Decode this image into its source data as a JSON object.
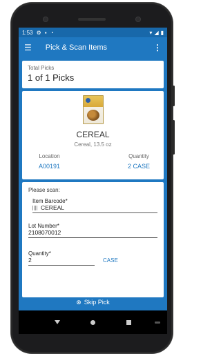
{
  "statusbar": {
    "time": "1:53"
  },
  "appbar": {
    "menu_icon": "menu-icon",
    "title": "Pick & Scan Items",
    "more_icon": "more-vert-icon"
  },
  "total": {
    "label": "Total Picks",
    "value": "1 of 1 Picks"
  },
  "item": {
    "name": "CEREAL",
    "description": "Cereal, 13.5 oz",
    "location_label": "Location",
    "location_value": "A00191",
    "quantity_label": "Quantity",
    "quantity_value": "2 CASE"
  },
  "scan": {
    "prompt": "Please scan:",
    "barcode_label": "Item Barcode*",
    "barcode_value": "CEREAL",
    "lot_label": "Lot Number*",
    "lot_value": "2108070012",
    "quantity_label": "Quantity*",
    "quantity_value": "2",
    "unit_link": "CASE"
  },
  "skip": {
    "label": "Skip Pick"
  },
  "colors": {
    "primary": "#1f78c1",
    "statusbar": "#1868aa",
    "nav": "#000000"
  }
}
